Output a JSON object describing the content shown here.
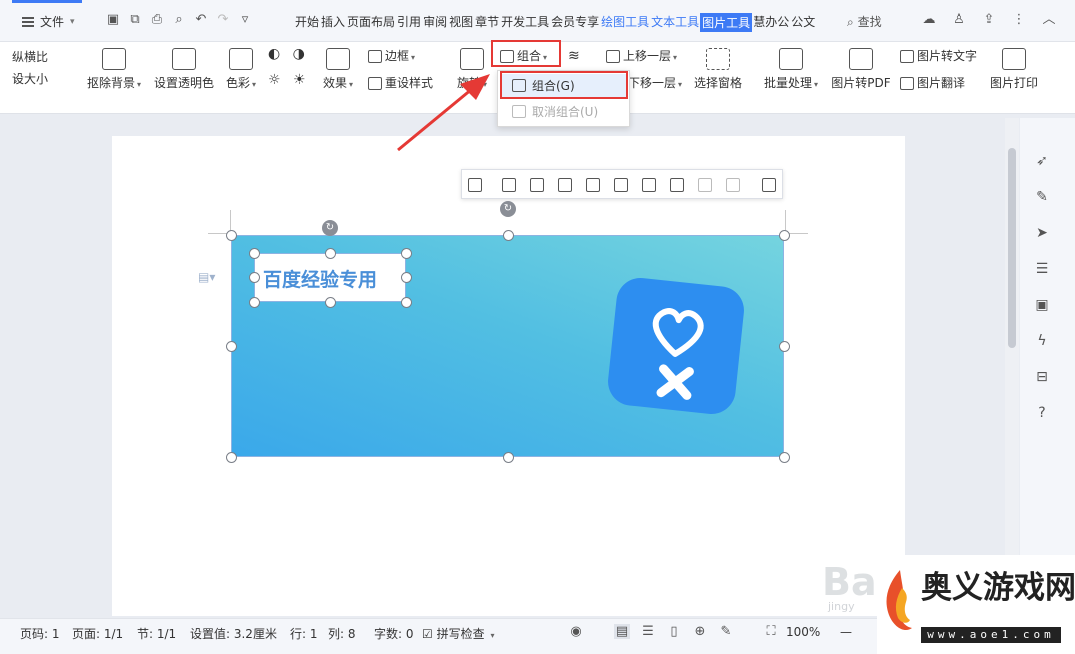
{
  "topbar": {
    "file_label": "文件",
    "tabs": [
      {
        "label": "开始",
        "style": "normal"
      },
      {
        "label": "插入",
        "style": "normal"
      },
      {
        "label": "页面布局",
        "style": "normal"
      },
      {
        "label": "引用",
        "style": "normal"
      },
      {
        "label": "审阅",
        "style": "normal"
      },
      {
        "label": "视图",
        "style": "normal"
      },
      {
        "label": "章节",
        "style": "normal"
      },
      {
        "label": "开发工具",
        "style": "normal"
      },
      {
        "label": "会员专享",
        "style": "normal"
      },
      {
        "label": "绘图工具",
        "style": "blue"
      },
      {
        "label": "文本工具",
        "style": "blue"
      },
      {
        "label": "图片工具",
        "style": "active"
      },
      {
        "label": "慧办公",
        "style": "normal"
      },
      {
        "label": "公文",
        "style": "normal"
      }
    ],
    "search_label": "查找",
    "accent_color": "#3d7af5"
  },
  "ribbon": {
    "left_line1": "纵横比",
    "left_line2": "设大小",
    "remove_bg": "抠除背景",
    "set_transparent": "设置透明色",
    "color": "色彩",
    "effects": "效果",
    "border": "边框",
    "reset_style": "重设样式",
    "rotate": "旋转",
    "group": "组合",
    "bring_forward": "上移一层",
    "send_backward": "下移一层",
    "selection_pane": "选择窗格",
    "batch": "批量处理",
    "to_pdf": "图片转PDF",
    "to_text": "图片转文字",
    "translate": "图片翻译",
    "print": "图片打印"
  },
  "dropdown": {
    "items": [
      {
        "label": "组合(G)",
        "enabled": true,
        "highlighted": true
      },
      {
        "label": "取消组合(U)",
        "enabled": false,
        "highlighted": false
      }
    ]
  },
  "document": {
    "textbox_text": "百度经验专用"
  },
  "statusbar": {
    "page_num": "页码: 1",
    "pages": "页面: 1/1",
    "section": "节: 1/1",
    "setting": "设置值: 3.2厘米",
    "row": "行: 1",
    "col": "列: 8",
    "wordcount": "字数: 0",
    "spellcheck": "拼写检查",
    "zoom": "100%"
  },
  "watermark": {
    "site_name": "奥义游戏网",
    "site_url": "www.aoe1.com",
    "baidu_text": "Bai",
    "baidu_sub": "jingy"
  },
  "colors": {
    "highlight_red": "#e53935",
    "banner_start": "#75d4df",
    "banner_end": "#3aa8ea",
    "logo_blue": "#2d8ef0"
  }
}
